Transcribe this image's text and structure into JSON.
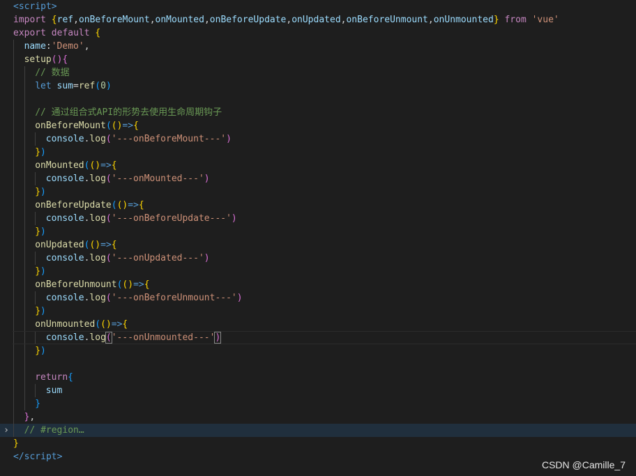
{
  "editor": {
    "fold_marker": "›",
    "lines": [
      {
        "indent": 0,
        "tokens": [
          [
            "t-tag",
            "<"
          ],
          [
            "t-tag",
            "script"
          ],
          [
            "t-tag",
            ">"
          ]
        ]
      },
      {
        "indent": 0,
        "tokens": [
          [
            "t-kw",
            "import "
          ],
          [
            "t-b1",
            "{"
          ],
          [
            "t-var",
            "ref"
          ],
          [
            "t-p",
            ","
          ],
          [
            "t-var",
            "onBeforeMount"
          ],
          [
            "t-p",
            ","
          ],
          [
            "t-var",
            "onMounted"
          ],
          [
            "t-p",
            ","
          ],
          [
            "t-var",
            "onBeforeUpdate"
          ],
          [
            "t-p",
            ","
          ],
          [
            "t-var",
            "onUpdated"
          ],
          [
            "t-p",
            ","
          ],
          [
            "t-var",
            "onBeforeUnmount"
          ],
          [
            "t-p",
            ","
          ],
          [
            "t-var",
            "onUnmounted"
          ],
          [
            "t-b1",
            "}"
          ],
          [
            "t-kw",
            " from "
          ],
          [
            "t-str",
            "'vue'"
          ]
        ]
      },
      {
        "indent": 0,
        "tokens": [
          [
            "t-kw",
            "export "
          ],
          [
            "t-kw",
            "default "
          ],
          [
            "t-b1",
            "{"
          ]
        ]
      },
      {
        "indent": 1,
        "tokens": [
          [
            "t-var",
            "name"
          ],
          [
            "t-p",
            ":"
          ],
          [
            "t-str",
            "'Demo'"
          ],
          [
            "t-p",
            ","
          ]
        ]
      },
      {
        "indent": 1,
        "tokens": [
          [
            "t-fn",
            "setup"
          ],
          [
            "t-b2",
            "("
          ],
          [
            "t-b2",
            ")"
          ],
          [
            "t-b2",
            "{"
          ]
        ]
      },
      {
        "indent": 2,
        "tokens": [
          [
            "t-cm",
            "// 数据"
          ]
        ]
      },
      {
        "indent": 2,
        "tokens": [
          [
            "t-kw2",
            "let "
          ],
          [
            "t-var",
            "sum"
          ],
          [
            "t-op",
            "="
          ],
          [
            "t-fn",
            "ref"
          ],
          [
            "t-b3",
            "("
          ],
          [
            "t-num",
            "0"
          ],
          [
            "t-b3",
            ")"
          ]
        ]
      },
      {
        "indent": 2,
        "tokens": []
      },
      {
        "indent": 2,
        "tokens": [
          [
            "t-cm",
            "// 通过组合式API的形势去使用生命周期钩子"
          ]
        ]
      },
      {
        "indent": 2,
        "tokens": [
          [
            "t-fn",
            "onBeforeMount"
          ],
          [
            "t-b3",
            "("
          ],
          [
            "t-b1",
            "("
          ],
          [
            "t-b1",
            ")"
          ],
          [
            "t-kw2",
            "=>"
          ],
          [
            "t-b1",
            "{"
          ]
        ]
      },
      {
        "indent": 3,
        "tokens": [
          [
            "t-var",
            "console"
          ],
          [
            "t-p",
            "."
          ],
          [
            "t-fn",
            "log"
          ],
          [
            "t-b2",
            "("
          ],
          [
            "t-str",
            "'---onBeforeMount---'"
          ],
          [
            "t-b2",
            ")"
          ]
        ]
      },
      {
        "indent": 2,
        "tokens": [
          [
            "t-b1",
            "}"
          ],
          [
            "t-b3",
            ")"
          ]
        ]
      },
      {
        "indent": 2,
        "tokens": [
          [
            "t-fn",
            "onMounted"
          ],
          [
            "t-b3",
            "("
          ],
          [
            "t-b1",
            "("
          ],
          [
            "t-b1",
            ")"
          ],
          [
            "t-kw2",
            "=>"
          ],
          [
            "t-b1",
            "{"
          ]
        ]
      },
      {
        "indent": 3,
        "tokens": [
          [
            "t-var",
            "console"
          ],
          [
            "t-p",
            "."
          ],
          [
            "t-fn",
            "log"
          ],
          [
            "t-b2",
            "("
          ],
          [
            "t-str",
            "'---onMounted---'"
          ],
          [
            "t-b2",
            ")"
          ]
        ]
      },
      {
        "indent": 2,
        "tokens": [
          [
            "t-b1",
            "}"
          ],
          [
            "t-b3",
            ")"
          ]
        ]
      },
      {
        "indent": 2,
        "tokens": [
          [
            "t-fn",
            "onBeforeUpdate"
          ],
          [
            "t-b3",
            "("
          ],
          [
            "t-b1",
            "("
          ],
          [
            "t-b1",
            ")"
          ],
          [
            "t-kw2",
            "=>"
          ],
          [
            "t-b1",
            "{"
          ]
        ]
      },
      {
        "indent": 3,
        "tokens": [
          [
            "t-var",
            "console"
          ],
          [
            "t-p",
            "."
          ],
          [
            "t-fn",
            "log"
          ],
          [
            "t-b2",
            "("
          ],
          [
            "t-str",
            "'---onBeforeUpdate---'"
          ],
          [
            "t-b2",
            ")"
          ]
        ]
      },
      {
        "indent": 2,
        "tokens": [
          [
            "t-b1",
            "}"
          ],
          [
            "t-b3",
            ")"
          ]
        ]
      },
      {
        "indent": 2,
        "tokens": [
          [
            "t-fn",
            "onUpdated"
          ],
          [
            "t-b3",
            "("
          ],
          [
            "t-b1",
            "("
          ],
          [
            "t-b1",
            ")"
          ],
          [
            "t-kw2",
            "=>"
          ],
          [
            "t-b1",
            "{"
          ]
        ]
      },
      {
        "indent": 3,
        "tokens": [
          [
            "t-var",
            "console"
          ],
          [
            "t-p",
            "."
          ],
          [
            "t-fn",
            "log"
          ],
          [
            "t-b2",
            "("
          ],
          [
            "t-str",
            "'---onUpdated---'"
          ],
          [
            "t-b2",
            ")"
          ]
        ]
      },
      {
        "indent": 2,
        "tokens": [
          [
            "t-b1",
            "}"
          ],
          [
            "t-b3",
            ")"
          ]
        ]
      },
      {
        "indent": 2,
        "tokens": [
          [
            "t-fn",
            "onBeforeUnmount"
          ],
          [
            "t-b3",
            "("
          ],
          [
            "t-b1",
            "("
          ],
          [
            "t-b1",
            ")"
          ],
          [
            "t-kw2",
            "=>"
          ],
          [
            "t-b1",
            "{"
          ]
        ]
      },
      {
        "indent": 3,
        "tokens": [
          [
            "t-var",
            "console"
          ],
          [
            "t-p",
            "."
          ],
          [
            "t-fn",
            "log"
          ],
          [
            "t-b2",
            "("
          ],
          [
            "t-str",
            "'---onBeforeUnmount---'"
          ],
          [
            "t-b2",
            ")"
          ]
        ]
      },
      {
        "indent": 2,
        "tokens": [
          [
            "t-b1",
            "}"
          ],
          [
            "t-b3",
            ")"
          ]
        ]
      },
      {
        "indent": 2,
        "tokens": [
          [
            "t-fn",
            "onUnmounted"
          ],
          [
            "t-b3",
            "("
          ],
          [
            "t-b1",
            "("
          ],
          [
            "t-b1",
            ")"
          ],
          [
            "t-kw2",
            "=>"
          ],
          [
            "t-b1",
            "{"
          ]
        ]
      },
      {
        "indent": 3,
        "current": true,
        "tokens": [
          [
            "t-var",
            "console"
          ],
          [
            "t-p",
            "."
          ],
          [
            "t-fn",
            "log"
          ],
          [
            "t-b2 t-match",
            "("
          ],
          [
            "t-str",
            "'---onUnmounted---'"
          ],
          [
            "t-b2 t-match",
            ")"
          ]
        ]
      },
      {
        "indent": 2,
        "tokens": [
          [
            "t-b1",
            "}"
          ],
          [
            "t-b3",
            ")"
          ]
        ]
      },
      {
        "indent": 2,
        "tokens": []
      },
      {
        "indent": 2,
        "tokens": [
          [
            "t-kw",
            "return"
          ],
          [
            "t-b3",
            "{"
          ]
        ]
      },
      {
        "indent": 3,
        "tokens": [
          [
            "t-var",
            "sum"
          ]
        ]
      },
      {
        "indent": 2,
        "tokens": [
          [
            "t-b3",
            "}"
          ]
        ]
      },
      {
        "indent": 1,
        "tokens": [
          [
            "t-b2",
            "}"
          ],
          [
            "t-p",
            ","
          ]
        ]
      },
      {
        "indent": 1,
        "folded": true,
        "tokens": [
          [
            "t-cm",
            "// #region"
          ],
          [
            "t-fold",
            "…"
          ]
        ]
      },
      {
        "indent": 0,
        "tokens": [
          [
            "t-b1",
            "}"
          ]
        ]
      },
      {
        "indent": 0,
        "tokens": [
          [
            "t-tag",
            "</"
          ],
          [
            "t-tag",
            "script"
          ],
          [
            "t-tag",
            ">"
          ]
        ]
      }
    ]
  },
  "watermark": "CSDN @Camille_7"
}
